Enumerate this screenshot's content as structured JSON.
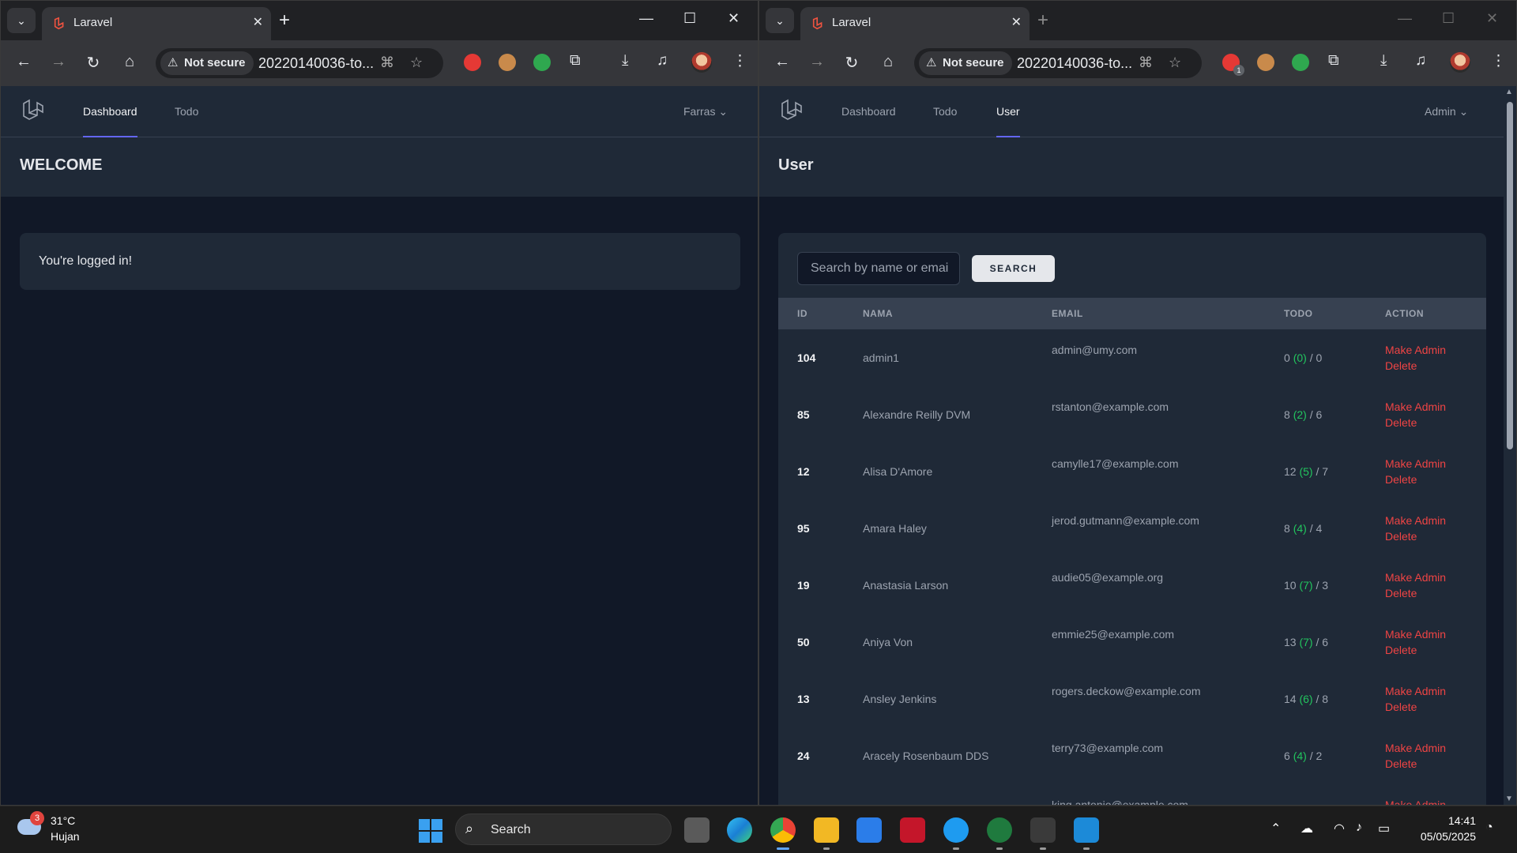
{
  "left": {
    "tab_title": "Laravel",
    "not_secure": "Not secure",
    "url": "20220140036-to...",
    "nav": {
      "dashboard": "Dashboard",
      "todo": "Todo"
    },
    "user_menu": "Farras",
    "header": "WELCOME",
    "message": "You're logged in!"
  },
  "right": {
    "tab_title": "Laravel",
    "not_secure": "Not secure",
    "url": "20220140036-to...",
    "ext_badge": "1",
    "nav": {
      "dashboard": "Dashboard",
      "todo": "Todo",
      "user": "User"
    },
    "user_menu": "Admin",
    "header": "User",
    "search": {
      "placeholder": "Search by name or emai",
      "button": "SEARCH"
    },
    "columns": [
      "ID",
      "NAMA",
      "EMAIL",
      "TODO",
      "ACTION"
    ],
    "actions": {
      "make_admin": "Make Admin",
      "delete": "Delete"
    },
    "users": [
      {
        "id": "104",
        "name": "admin1",
        "email": "admin@umy.com",
        "todo_a": "0",
        "todo_b": "(0)",
        "todo_c": "/ 0"
      },
      {
        "id": "85",
        "name": "Alexandre Reilly DVM",
        "email": "rstanton@example.com",
        "todo_a": "8",
        "todo_b": "(2)",
        "todo_c": "/ 6"
      },
      {
        "id": "12",
        "name": "Alisa D'Amore",
        "email": "camylle17@example.com",
        "todo_a": "12",
        "todo_b": "(5)",
        "todo_c": "/ 7"
      },
      {
        "id": "95",
        "name": "Amara Haley",
        "email": "jerod.gutmann@example.com",
        "todo_a": "8",
        "todo_b": "(4)",
        "todo_c": "/ 4"
      },
      {
        "id": "19",
        "name": "Anastasia Larson",
        "email": "audie05@example.org",
        "todo_a": "10",
        "todo_b": "(7)",
        "todo_c": "/ 3"
      },
      {
        "id": "50",
        "name": "Aniya Von",
        "email": "emmie25@example.com",
        "todo_a": "13",
        "todo_b": "(7)",
        "todo_c": "/ 6"
      },
      {
        "id": "13",
        "name": "Ansley Jenkins",
        "email": "rogers.deckow@example.com",
        "todo_a": "14",
        "todo_b": "(6)",
        "todo_c": "/ 8"
      },
      {
        "id": "24",
        "name": "Aracely Rosenbaum DDS",
        "email": "terry73@example.com",
        "todo_a": "6",
        "todo_b": "(4)",
        "todo_c": "/ 2"
      },
      {
        "id": "",
        "name": "",
        "email": "king.antonio@example.com",
        "todo_a": "",
        "todo_b": "",
        "todo_c": ""
      }
    ]
  },
  "taskbar": {
    "weather_badge": "3",
    "temp": "31°C",
    "condition": "Hujan",
    "search": "Search",
    "time": "14:41",
    "date": "05/05/2025"
  }
}
